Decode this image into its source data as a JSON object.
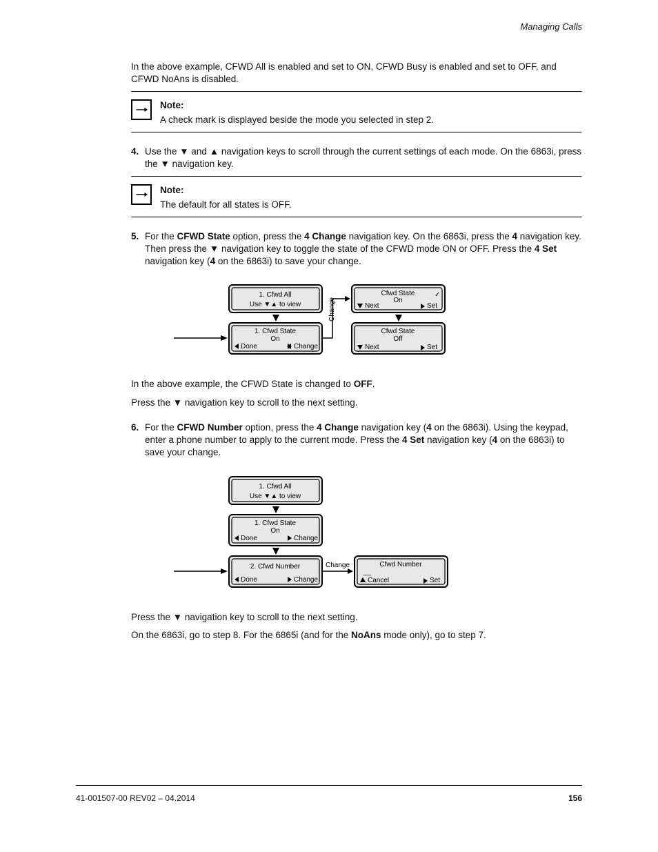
{
  "header": {
    "section_title": "Managing Calls"
  },
  "intro": {
    "text": "In the above example, CFWD All is enabled and set to ON, CFWD Busy is enabled and set to OFF, and CFWD NoAns is disabled."
  },
  "note1": {
    "title": "Note:",
    "body": "A check mark is displayed beside the mode you selected in step 2."
  },
  "step4": {
    "num": "4.",
    "text_prefix": "Use the ",
    "text_keys1": "▼",
    "text_mid1": " and ",
    "text_keys2": "▲",
    "text_mid2": " navigation keys to scroll through the current settings of each mode. On the 6863i, press the ",
    "text_keys3": "▼",
    "text_mid3": " navigation key."
  },
  "note2": {
    "title": "Note:",
    "body": "The default for all states is OFF."
  },
  "step5": {
    "num": "5.",
    "text": "For the CFWD State option, press the 4 Change navigation key. On the 6863i, press the 4 navigation key. Then press the ▼ navigation key to toggle the state of the CFWD mode ON or OFF. Press the 4 Set navigation key (4 on the 6863i) to save your change.",
    "text_prefix": "For the ",
    "bold1": "CFWD State",
    "mid1": " option, press the ",
    "bold2": "4 Change",
    "mid2": " navigation key. On the 6863i, press the ",
    "bold3": "4",
    "mid3": " navigation key. Then press the ",
    "bold4": "▼",
    "mid4": " navigation key to toggle the state of the CFWD mode ON or OFF. Press the ",
    "bold5": "4 Set",
    "mid5": " navigation key (",
    "bold6": "4",
    "mid6": " on the 6863i) to save your change."
  },
  "diagram1": {
    "boxA": {
      "line1": "1. Cfwd All",
      "line2a": "Use ",
      "line2b": " to view"
    },
    "boxB": {
      "line1": "1. Cfwd State",
      "line2": "On",
      "left": "Done",
      "right": "Change"
    },
    "boxC": {
      "line1": "Cfwd State",
      "line2": "On",
      "left": "Next",
      "right": "Set",
      "check": "✓"
    },
    "boxD": {
      "line1": "Cfwd State",
      "line2": "Off",
      "left": "Next",
      "right": "Set"
    },
    "link_label": "Change"
  },
  "after_d1": {
    "p1_a": "In the above example, the CFWD State is changed to ",
    "p1_b": "OFF",
    "p1_c": ".",
    "p2_a": "Press the ",
    "p2_b": "▼",
    "p2_c": " navigation key to scroll to the next setting."
  },
  "step6": {
    "num": "6.",
    "pre": "For the ",
    "b1": "CFWD Number",
    "mid1": " option, press the ",
    "b2": "4 Change",
    "mid2": " navigation key (",
    "b3": "4",
    "mid3": " on the 6863i). Using the keypad, enter a phone number to apply to the current mode. Press the ",
    "b4": "4 Set",
    "mid4": " navigation key (",
    "b5": "4",
    "mid5": " on the 6863i) to save your change."
  },
  "diagram2": {
    "boxA": {
      "line1": "1. Cfwd All",
      "line2a": "Use ",
      "line2b": " to view"
    },
    "boxB": {
      "line1": "1. Cfwd State",
      "line2": "On",
      "left": "Done",
      "right": "Change"
    },
    "boxC": {
      "line1": "2. Cfwd Number",
      "line2": "",
      "left": "Done",
      "right": "Change"
    },
    "boxD": {
      "line1": "Cfwd Number",
      "line2": "__",
      "left": "Cancel",
      "right": "Set"
    },
    "link_label": "Change"
  },
  "after_d2": {
    "a": "Press the ",
    "b": "▼",
    "c": " navigation key to scroll to the next setting.",
    "p2_a": "On the 6863i, go to step 8. For the 6865i (and for the ",
    "p2_b": "NoAns",
    "p2_c": " mode only), go to step 7."
  },
  "footer": {
    "doc": "41-001507-00 REV02 – 04.2014",
    "page": "156"
  }
}
